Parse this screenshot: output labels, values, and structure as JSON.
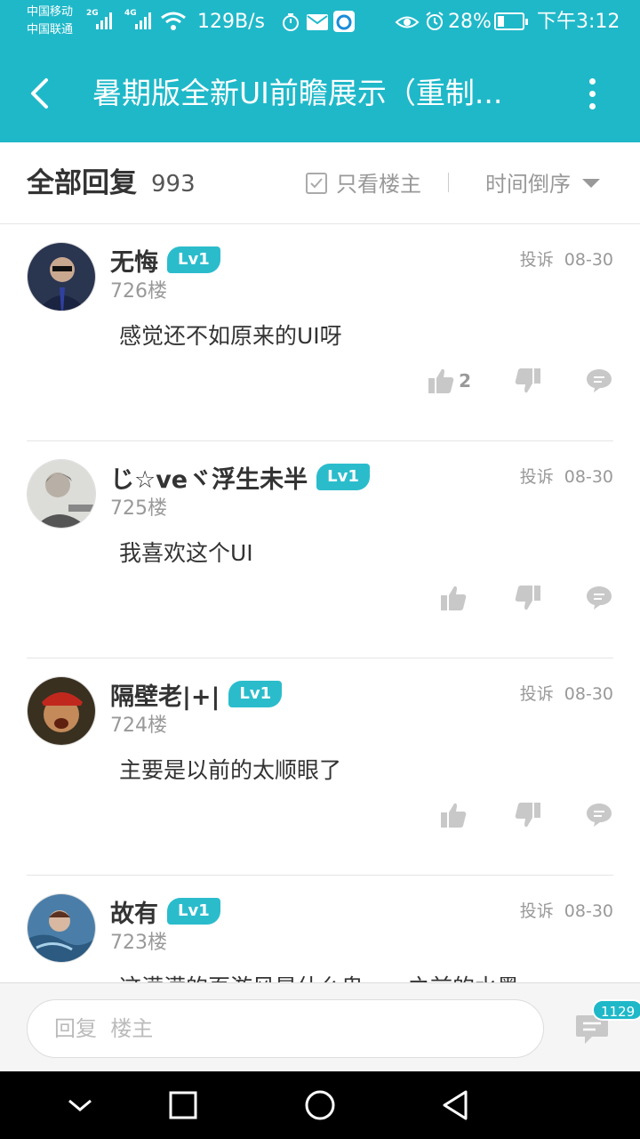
{
  "status_bar": {
    "carrier_1": "中国移动",
    "carrier_2": "中国联通",
    "sim1_network": "2G",
    "sim2_network": "4G",
    "net_speed": "129B/s",
    "battery_percent": "28%",
    "battery_level": 0.28,
    "time": "下午3:12",
    "icons": [
      "signal-icon",
      "wifi-icon",
      "stopwatch-icon",
      "mail-icon",
      "app-icon",
      "eye-icon",
      "alarm-icon",
      "battery-icon"
    ]
  },
  "header": {
    "title": "暑期版全新UI前瞻展示（重制...",
    "back_icon": "chevron-left-icon",
    "more_icon": "more-vertical-icon"
  },
  "filter": {
    "title": "全部回复",
    "count": "993",
    "only_op_label": "只看楼主",
    "sort_label": "时间倒序"
  },
  "posts": [
    {
      "username": "无悔",
      "level": "Lv1",
      "floor": "726楼",
      "report": "投诉",
      "date": "08-30",
      "content": "感觉还不如原来的UI呀",
      "likes": "2"
    },
    {
      "username": "じ☆veヾ浮生未半",
      "level": "Lv1",
      "floor": "725楼",
      "report": "投诉",
      "date": "08-30",
      "content": "我喜欢这个UI",
      "likes": ""
    },
    {
      "username": "隔壁老|+|",
      "level": "Lv1",
      "floor": "724楼",
      "report": "投诉",
      "date": "08-30",
      "content": "主要是以前的太顺眼了",
      "likes": ""
    },
    {
      "username": "故有",
      "level": "Lv1",
      "floor": "723楼",
      "report": "投诉",
      "date": "08-30",
      "content": "这满满的页游风是什么鬼……之前的水墨",
      "likes": ""
    }
  ],
  "reply_bar": {
    "placeholder": "回复  楼主",
    "comment_count": "1129"
  },
  "colors": {
    "accent": "#1fb8c9",
    "level_badge": "#2bbccc",
    "icon_gray": "#c8c8c8"
  }
}
